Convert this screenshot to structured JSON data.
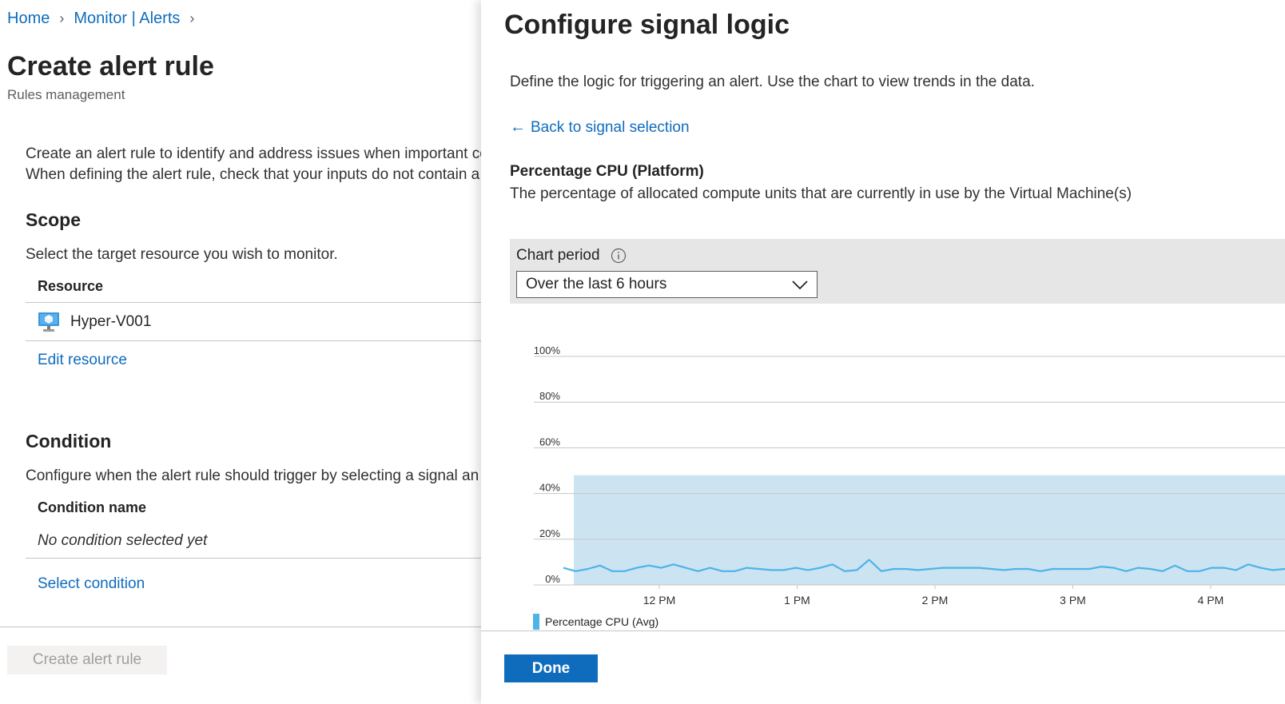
{
  "breadcrumb": {
    "items": [
      "Home",
      "Monitor | Alerts"
    ]
  },
  "page": {
    "title": "Create alert rule",
    "subtitle": "Rules management"
  },
  "intro": {
    "line1": "Create an alert rule to identify and address issues when important co",
    "line2": "When defining the alert rule, check that your inputs do not contain a"
  },
  "scope": {
    "heading": "Scope",
    "description": "Select the target resource you wish to monitor.",
    "column_header": "Resource",
    "resource_name": "Hyper-V001",
    "resource_icon": "virtual-machine-icon",
    "edit_link": "Edit resource"
  },
  "condition": {
    "heading": "Condition",
    "description": "Configure when the alert rule should trigger by selecting a signal an",
    "column_header": "Condition name",
    "empty_text": "No condition selected yet",
    "select_link": "Select condition"
  },
  "footer": {
    "create_button": "Create alert rule"
  },
  "flyout": {
    "title": "Configure signal logic",
    "description": "Define the logic for triggering an alert. Use the chart to view trends in the data.",
    "back_link": "Back to signal selection",
    "metric_name": "Percentage CPU (Platform)",
    "metric_description": "The percentage of allocated compute units that are currently in use by the Virtual Machine(s)",
    "chart_period_label": "Chart period",
    "chart_period_value": "Over the last 6 hours",
    "done_button": "Done"
  },
  "colors": {
    "accent": "#0f6cbd",
    "series": "#4cb4e7",
    "highlight": "#cce3f2"
  },
  "chart_data": {
    "type": "line",
    "yticks": [
      "100%",
      "80%",
      "60%",
      "40%",
      "20%",
      "0%"
    ],
    "xticks": [
      "12 PM",
      "1 PM",
      "2 PM",
      "3 PM",
      "4 PM"
    ],
    "ylim": [
      0,
      100
    ],
    "legend": "Percentage CPU (Avg)",
    "series": [
      {
        "name": "Percentage CPU (Avg)",
        "values": [
          7.5,
          6,
          7,
          8.5,
          6,
          6,
          7.5,
          8.5,
          7.5,
          9,
          7.5,
          6,
          7.5,
          6,
          6,
          7.5,
          7,
          6.5,
          6.5,
          7.5,
          6.5,
          7.5,
          9,
          6,
          6.5,
          11,
          6,
          7,
          7,
          6.5,
          7,
          7.5,
          7.5,
          7.5,
          7.5,
          7,
          6.5,
          7,
          7,
          6,
          7,
          7,
          7,
          7,
          8,
          7.5,
          6,
          7.5,
          7,
          6,
          8.5,
          6,
          6,
          7.5,
          7.5,
          6.5,
          9,
          7.5,
          6.5,
          7
        ]
      }
    ]
  }
}
